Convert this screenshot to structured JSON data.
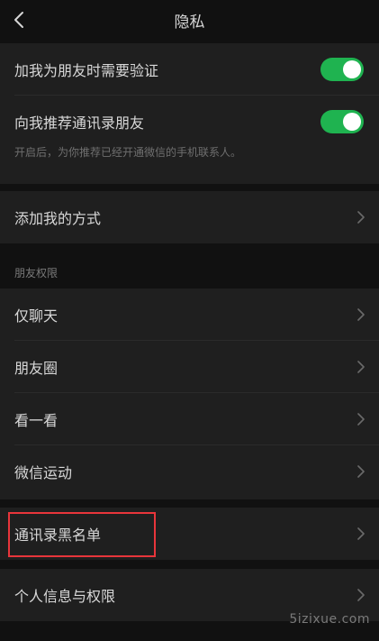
{
  "header": {
    "title": "隐私"
  },
  "verification": {
    "add_friend_verify": "加我为朋友时需要验证",
    "recommend_contacts": "向我推荐通讯录朋友",
    "recommend_hint": "开启后，为你推荐已经开通微信的手机联系人。",
    "add_friend_verify_on": true,
    "recommend_contacts_on": true
  },
  "ways": {
    "add_me_ways": "添加我的方式"
  },
  "permissions": {
    "section_title": "朋友权限",
    "items": [
      {
        "label": "仅聊天"
      },
      {
        "label": "朋友圈"
      },
      {
        "label": "看一看"
      },
      {
        "label": "微信运动"
      }
    ]
  },
  "blacklist": {
    "label": "通讯录黑名单"
  },
  "personal": {
    "label": "个人信息与权限"
  },
  "watermark": "5izixue.com",
  "colors": {
    "background": "#111111",
    "row_background": "#1f1f1f",
    "toggle_on": "#1fb350",
    "highlight_border": "#e8353b"
  }
}
